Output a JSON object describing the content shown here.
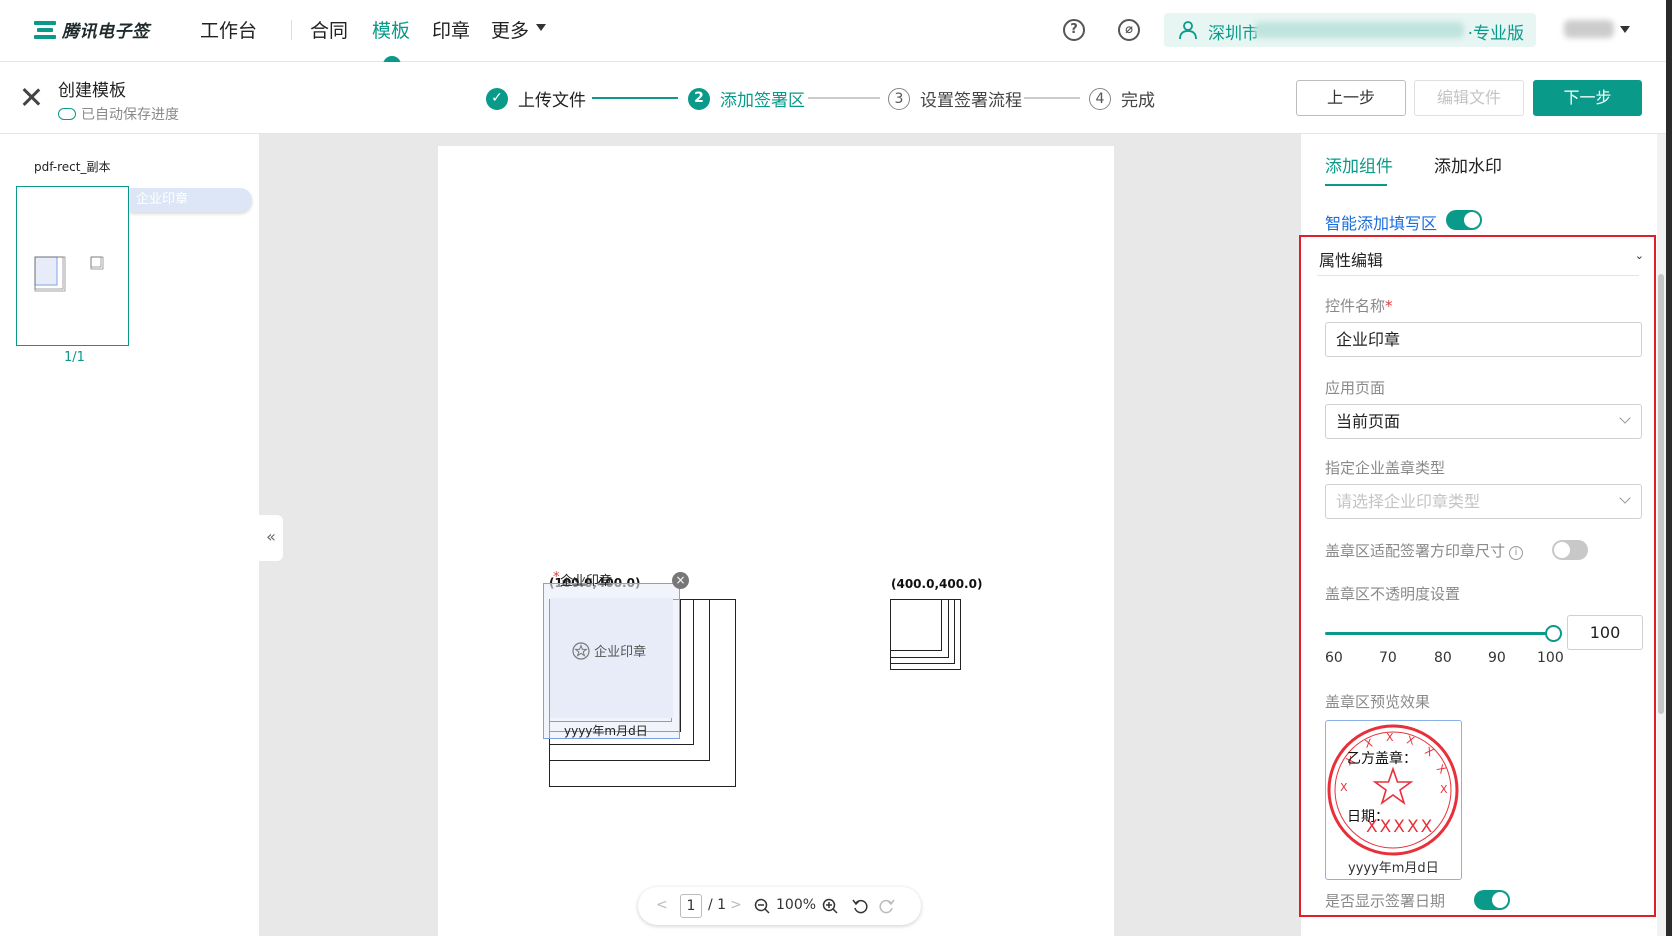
{
  "app": {
    "logo_text": "腾讯电子签",
    "nav": [
      "工作台",
      "合同",
      "模板",
      "印章",
      "更多"
    ],
    "active_nav": "模板",
    "help_icon": "question-circle-icon",
    "compass_icon": "compass-icon",
    "org": {
      "name": "深圳市",
      "edition": "·专业版"
    },
    "accent_color": "#0a9a8a"
  },
  "header": {
    "title": "创建模板",
    "autosave": "已自动保存进度",
    "steps": [
      {
        "num": "✓",
        "label": "上传文件",
        "state": "done"
      },
      {
        "num": "2",
        "label": "添加签署区",
        "state": "current"
      },
      {
        "num": "3",
        "label": "设置签署流程",
        "state": "todo"
      },
      {
        "num": "4",
        "label": "完成",
        "state": "todo"
      }
    ],
    "buttons": {
      "prev": "上一步",
      "edit": "编辑文件",
      "next": "下一步"
    }
  },
  "left": {
    "doc_name": "pdf-rect_副本",
    "thumb_tag": "企业印章",
    "page_count": "1/1"
  },
  "canvas": {
    "collapse_label": "«",
    "coord_left": "(100.0,400.0)",
    "coord_right": "(400.0,400.0)",
    "seal_title": "企业印章",
    "seal_required": "*",
    "seal_label": "企业印章",
    "seal_date": "yyyy年m月d日",
    "seal_delete": "×",
    "zoom": {
      "prev": "<",
      "page": "1",
      "total": "/ 1",
      "next": ">",
      "zoom_level": "100%"
    }
  },
  "right": {
    "tabs": [
      "添加组件",
      "添加水印"
    ],
    "smart_fill": "智能添加填写区",
    "smart_fill_on": true,
    "section_title": "属性编辑",
    "section_chev": "⌄",
    "control_name_label": "控件名称",
    "control_name_value": "企业印章",
    "apply_page_label": "应用页面",
    "apply_page_value": "当前页面",
    "seal_type_label": "指定企业盖章类型",
    "seal_type_placeholder": "请选择企业印章类型",
    "fit_size_label": "盖章区适配签署方印章尺寸",
    "fit_size_on": false,
    "opacity_label": "盖章区不透明度设置",
    "opacity_value": "100",
    "opacity_ticks": [
      "60",
      "70",
      "80",
      "90",
      "100"
    ],
    "preview_label": "盖章区预览效果",
    "preview_seal_party": "乙方盖章：",
    "preview_seal_date_label": "日期：",
    "preview_seal_xs_top": "XXXXXX",
    "preview_seal_xs_bottom": "XXXXX",
    "preview_date": "yyyy年m月d日",
    "show_date_label": "是否显示签署日期",
    "show_date_on": true
  }
}
